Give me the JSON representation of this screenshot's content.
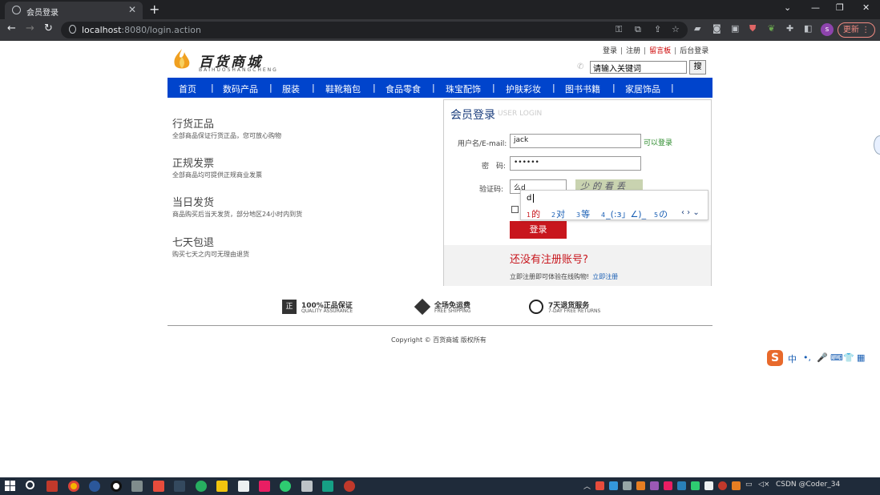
{
  "browser": {
    "tab_title": "会员登录",
    "tab_close": "✕",
    "new_tab": "+",
    "url_host": "localhost",
    "url_rest": ":8080/login.action",
    "update_label": "更新",
    "avatar_letter": "s",
    "min": "—",
    "max": "❐",
    "close": "✕",
    "chevron": "⌄"
  },
  "site": {
    "logo_cn": "百货商城",
    "logo_en": "BAIHUOSHANGCHENG",
    "top_links": {
      "login": "登录",
      "register": "注册",
      "guestbook": "留言板",
      "admin": "后台登录"
    },
    "search_placeholder": "请输入关键词",
    "search_button": "搜"
  },
  "nav": [
    "首页",
    "数码产品",
    "服装",
    "鞋靴箱包",
    "食品零食",
    "珠宝配饰",
    "护肤彩妆",
    "图书书籍",
    "家居饰品"
  ],
  "features": [
    {
      "title": "行货正品",
      "desc": "全部商品保证行货正品，您可放心购物"
    },
    {
      "title": "正规发票",
      "desc": "全部商品均可提供正规商业发票"
    },
    {
      "title": "当日发货",
      "desc": "商品购买后当天发货，部分地区24小时内到货"
    },
    {
      "title": "七天包退",
      "desc": "购买七天之内可无理由退货"
    }
  ],
  "login": {
    "title": "会员登录",
    "title_en": "USER LOGIN",
    "username_label": "用户名/E-mail:",
    "username_value": "jack",
    "username_status": "可以登录",
    "password_label": "密　码:",
    "password_value": "••••••",
    "captcha_label": "验证码:",
    "captcha_value": "么d",
    "captcha_image_text": "少的看丢",
    "submit": "登录",
    "no_account": "还没有注册账号?",
    "register_desc": "立即注册即可体验在线购物!",
    "register_link": "立即注册"
  },
  "ime": {
    "composition": "d",
    "candidates": [
      {
        "n": "1",
        "text": "的"
      },
      {
        "n": "2",
        "text": "对"
      },
      {
        "n": "3",
        "text": "等"
      },
      {
        "n": "4",
        "text": "_(:з」∠)_"
      },
      {
        "n": "5",
        "text": "の"
      }
    ],
    "nav": "‹ › ⌄"
  },
  "services": [
    {
      "icon": "正",
      "title": "100%正品保证",
      "sub": "QUALITY ASSURANCE"
    },
    {
      "icon": "",
      "title": "全场免运费",
      "sub": "FREE SHIPPING"
    },
    {
      "icon": "",
      "title": "7天退货服务",
      "sub": "7-DAY FREE RETURNS"
    }
  ],
  "copyright": "Copyright © 百货商城 版权所有",
  "ime_toolbar": {
    "logo": "S",
    "lang": "中",
    "punct": "•,",
    "mic": "🎤",
    "kbd": "⌨",
    "skin": "👕",
    "grid": "▦"
  },
  "taskbar": {
    "tray_text": "CSDN @Coder_34"
  },
  "colors": {
    "nav_blue": "#0044cc",
    "login_red": "#c8161d",
    "title_blue": "#1a3d7c"
  }
}
